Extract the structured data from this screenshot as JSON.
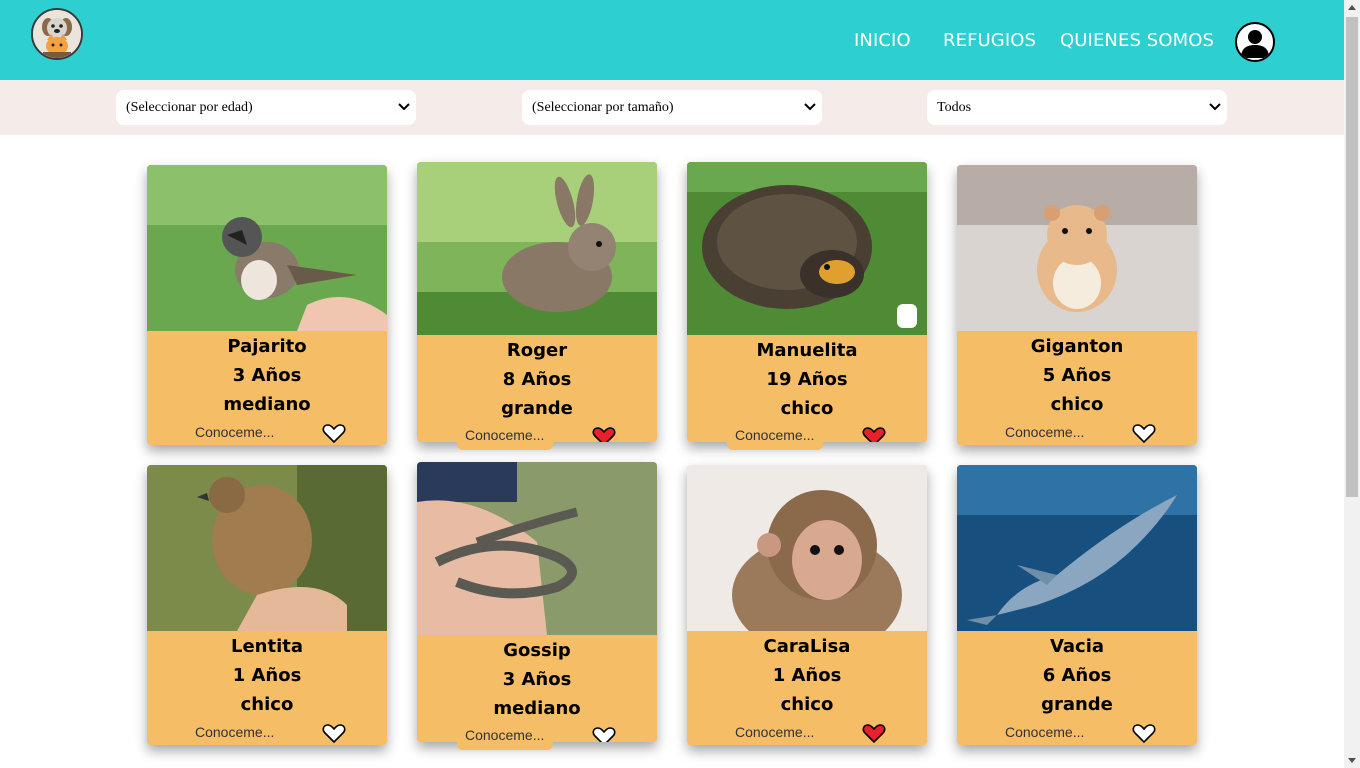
{
  "nav": {
    "inicio": "INICIO",
    "refugios": "REFUGIOS",
    "quienes": "QUIENES SOMOS"
  },
  "filters": {
    "edad": "(Seleccionar por edad)",
    "tamano": "(Seleccionar por tamaño)",
    "tipo": "Todos"
  },
  "more_label": "Conoceme...",
  "cards": [
    {
      "name": "Pajarito",
      "age": "3 Años",
      "size": "mediano",
      "favorite": false
    },
    {
      "name": "Roger",
      "age": "8 Años",
      "size": "grande",
      "favorite": true
    },
    {
      "name": "Manuelita",
      "age": "19 Años",
      "size": "chico",
      "favorite": true
    },
    {
      "name": "Giganton",
      "age": "5 Años",
      "size": "chico",
      "favorite": false
    },
    {
      "name": "Lentita",
      "age": "1 Años",
      "size": "chico",
      "favorite": false
    },
    {
      "name": "Gossip",
      "age": "3 Años",
      "size": "mediano",
      "favorite": false
    },
    {
      "name": "CaraLisa",
      "age": "1 Años",
      "size": "chico",
      "favorite": true
    },
    {
      "name": "Vacia",
      "age": "6 Años",
      "size": "grande",
      "favorite": false
    }
  ],
  "colors": {
    "header": "#2ecfd1",
    "card": "#f5bd66",
    "filterbar": "#f5ecea",
    "heart_fav": "#e8202a"
  }
}
